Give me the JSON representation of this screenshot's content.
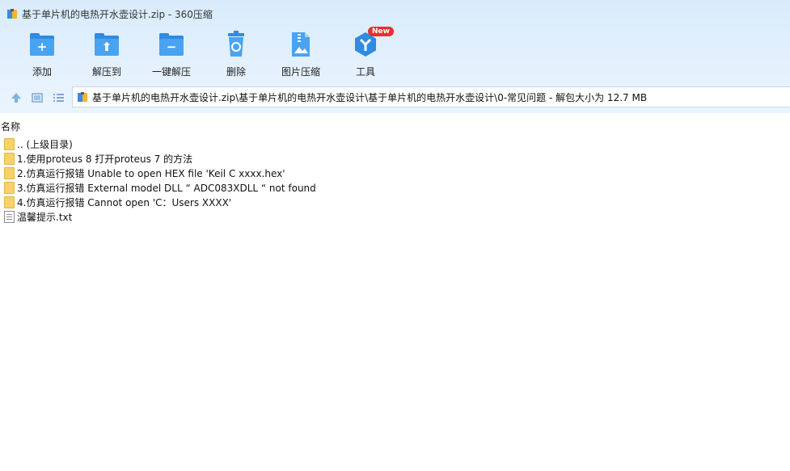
{
  "window": {
    "title": "基于单片机的电热开水壶设计.zip - 360压缩"
  },
  "toolbar": {
    "items": [
      {
        "label": "添加",
        "icon": "add-folder-icon"
      },
      {
        "label": "解压到",
        "icon": "extract-to-icon"
      },
      {
        "label": "一键解压",
        "icon": "one-click-extract-icon"
      },
      {
        "label": "删除",
        "icon": "recycle-bin-icon"
      },
      {
        "label": "图片压缩",
        "icon": "image-compress-icon"
      },
      {
        "label": "工具",
        "icon": "tools-icon"
      }
    ],
    "new_badge": "New"
  },
  "address": {
    "path": "基于单片机的电热开水壶设计.zip\\基于单片机的电热开水壶设计\\基于单片机的电热开水壶设计\\0-常见问题 - 解包大小为 12.7 MB"
  },
  "list": {
    "column_name": "名称",
    "rows": [
      {
        "name": ".. (上级目录)",
        "type": "folder"
      },
      {
        "name": "1.使用proteus 8 打开proteus 7 的方法",
        "type": "folder"
      },
      {
        "name": "2.仿真运行报错  Unable to open HEX file 'Keil C xxxx.hex'",
        "type": "folder"
      },
      {
        "name": "3.仿真运行报错  External model DLL “ ADC083XDLL “ not found",
        "type": "folder"
      },
      {
        "name": "4.仿真运行报错  Cannot open 'C：Users XXXX'",
        "type": "folder"
      },
      {
        "name": "温馨提示.txt",
        "type": "txt"
      }
    ]
  },
  "colors": {
    "accent": "#2f8be3",
    "toolbar_bg": "#e4f1fd",
    "folder": "#f7d26a",
    "badge": "#ea2f2f"
  }
}
